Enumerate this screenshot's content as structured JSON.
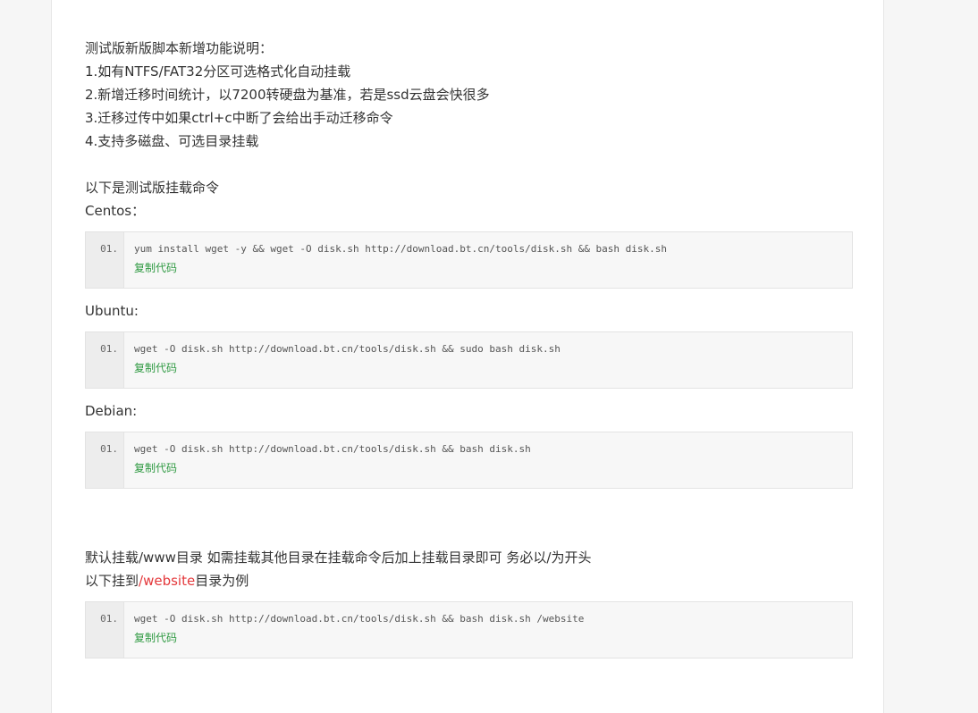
{
  "intro": {
    "heading": "测试版新版脚本新增功能说明：",
    "items": [
      "1.如有NTFS/FAT32分区可选格式化自动挂载",
      "2.新增迁移时间统计，以7200转硬盘为基准，若是ssd云盘会快很多",
      "3.迁移过传中如果ctrl+c中断了会给出手动迁移命令",
      "4.支持多磁盘、可选目录挂载"
    ]
  },
  "mount_intro": "以下是测试版挂载命令",
  "copy_label": "复制代码",
  "sections": [
    {
      "label": "Centos：",
      "line_no": "01.",
      "code": "yum install wget -y && wget -O disk.sh http://download.bt.cn/tools/disk.sh && bash disk.sh"
    },
    {
      "label": "Ubuntu:",
      "line_no": "01.",
      "code": "wget -O disk.sh http://download.bt.cn/tools/disk.sh && sudo bash disk.sh"
    },
    {
      "label": "Debian:",
      "line_no": "01.",
      "code": "wget -O disk.sh http://download.bt.cn/tools/disk.sh && bash disk.sh"
    }
  ],
  "default_note": {
    "line1": "默认挂载/www目录 如需挂载其他目录在挂载命令后加上挂载目录即可 务必以/为开头",
    "line2_prefix": "以下挂到",
    "line2_highlight": "/website",
    "line2_suffix": "目录为例"
  },
  "website_block": {
    "line_no": "01.",
    "code": "wget -O disk.sh http://download.bt.cn/tools/disk.sh && bash disk.sh /website"
  },
  "colors": {
    "highlight": "#e4393c",
    "copy_link": "#2f9a42"
  }
}
